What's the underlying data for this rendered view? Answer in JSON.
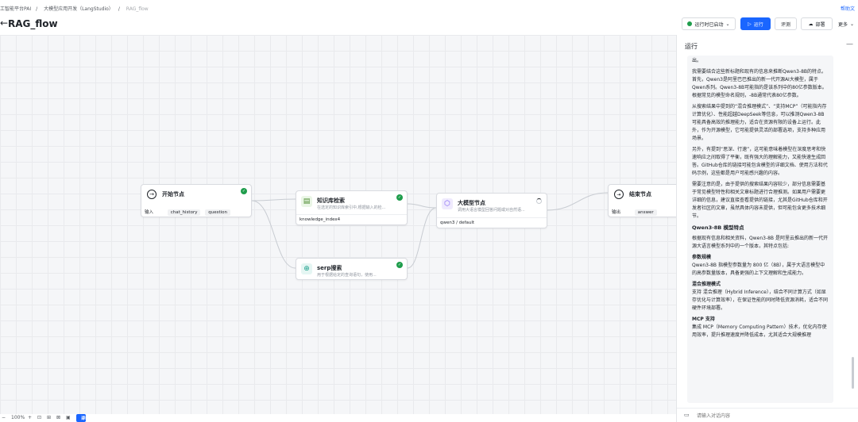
{
  "breadcrumb": {
    "item1": "工智能平台PAI",
    "item2": "大模型应用开发（LangStudio）",
    "current": "RAG_flow"
  },
  "help_link": "帮助文",
  "page": {
    "back_glyph": "←",
    "title": "RAG_flow"
  },
  "toolbar": {
    "runtime_label": "运行时已启动",
    "run_label": "运行",
    "evaluate_label": "评测",
    "deploy_label": "部署",
    "more_label": "更多"
  },
  "nodes": {
    "start": {
      "title": "开始节点",
      "input_label": "输入",
      "inputs": [
        "chat_history",
        "question"
      ]
    },
    "kb": {
      "title": "知识库检索",
      "desc": "在选定的知识库索引中,根据输入的检...",
      "footer": "knowledge_index4"
    },
    "llm": {
      "title": "大模型节点",
      "desc": "调用大语言模型回答问题或对自然语...",
      "footer": "qwen3 / default"
    },
    "serp": {
      "title": "serp搜索",
      "desc": "用于根据给定的查询语句，使用..."
    },
    "end": {
      "title": "结束节点",
      "output_label": "输出",
      "outputs": [
        "answer"
      ]
    }
  },
  "panel": {
    "title": "运行",
    "close_glyph": "—",
    "paragraphs": [
      "出。",
      "我需要结合这些新标题和现有的信息来推断Qwen3-8B的特点。首先，Qwen3是阿里巴巴推出的新一代开源AI大模型，属于Qwen系列。Qwen3-8B可能指的是该系列中的80亿参数版本。根据常见的模型命名规则，-8B通常代表80亿参数。",
      "从搜索结果中提到的“混合推理模式”、“支持MCP”（可能指内存计算优化）、性能超越DeepSeek等信息，可以推测Qwen3-8B可能具备高效的推理能力，适合在资源有限的设备上运行。此外，作为开源模型，它可能提供灵活的部署选项，支持多种应用场景。",
      "另外，有提到“思深、行速”，这可能意味着模型在深度思考和快速响应之间取得了平衡，既有强大的理解能力，又能快速生成回答。GitHub仓库的链接可能包含模型的详细文档、使用方法和代码示例，这些都是用户可能感兴趣的内容。",
      "需要注意的是，由于提供的搜索结果内容较少，部分信息需要基于常见模型特性和相关文章标题进行合理推测。如果用户需要更详细的信息，建议直接查看提供的链接，尤其是GitHub仓库和开发者社区的文章，虽然具体内容未提供，但可能包含更多技术细节。"
    ],
    "section_title": "Qwen3-8B 模型特点",
    "intro": "根据现有信息和相关资料，Qwen3-8B 是阿里云推出的新一代开源大语言模型系列中的一个版本，其特点包括:",
    "features": [
      {
        "title": "参数规模",
        "text": "Qwen3-8B 指模型参数量为 800 亿（8B），属于大语言模型中的高参数量版本，具备更强的上下文理解和生成能力。"
      },
      {
        "title": "混合推理模式",
        "text": "支持 混合推理（Hybrid Inference），结合不同计算方式（如显存优化与计算效率），在保证性能的同时降低资源消耗，适合不同硬件环境部署。"
      },
      {
        "title": "MCP 支持",
        "text": "集成 MCP（Memory Computing Pattern）技术，优化内存使用效率，提升推理速度并降低成本，尤其适合大规模推理"
      }
    ],
    "input_placeholder": "请输入对话内容"
  },
  "bottom": {
    "zoom": "100%",
    "add_node_label": "添加节点"
  }
}
